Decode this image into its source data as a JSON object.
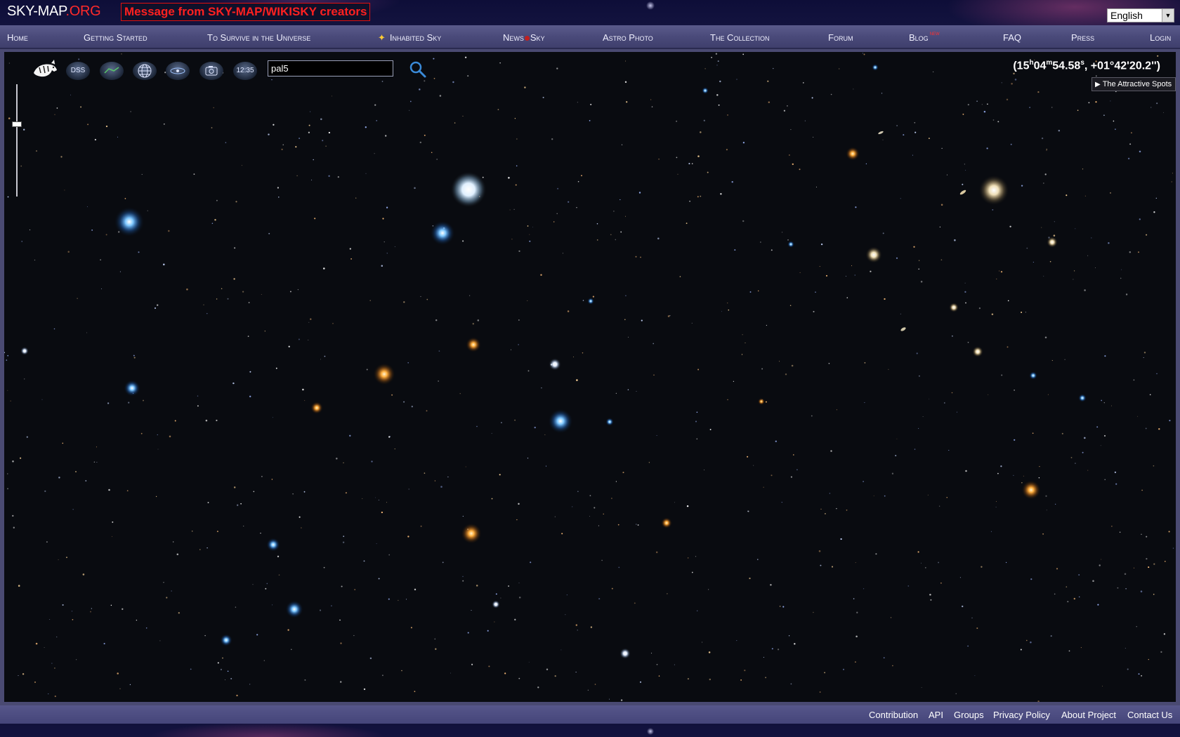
{
  "header": {
    "logo_main": "SKY-MAP",
    "logo_domain": ".ORG",
    "message": "Message from SKY-MAP/WIKISKY creators",
    "language": "English"
  },
  "nav": {
    "items": [
      {
        "label": "Home"
      },
      {
        "label": "Getting Started"
      },
      {
        "label": "To Survive in the Universe"
      },
      {
        "label": "Inhabited Sky"
      },
      {
        "label_a": "News",
        "label_b": "Sky"
      },
      {
        "label": "Astro Photo"
      },
      {
        "label": "The Collection"
      },
      {
        "label": "Forum"
      },
      {
        "label": "Blog",
        "badge": "new"
      },
      {
        "label": "FAQ"
      },
      {
        "label": "Press"
      },
      {
        "label": "Login"
      }
    ]
  },
  "toolbar": {
    "dss_label": "DSS",
    "time_label": "12:35",
    "icons": [
      "tiger-icon",
      "dss-survey-icon",
      "constellation-icon",
      "grid-globe-icon",
      "galaxy-icon",
      "camera-icon",
      "clock-icon",
      "search-icon"
    ],
    "search_value": "pal5"
  },
  "coordinates": {
    "open": "(15",
    "h_unit": "h",
    "min": "04",
    "m_unit": "m",
    "sec": "54.58",
    "s_unit": "s",
    "dec": ", +01°42'20.2'')"
  },
  "attractive_spots": "The Attractive Spots",
  "zoom_level": 0.35,
  "footer": {
    "links": [
      "Contribution",
      "API",
      "Groups",
      "Privacy Policy",
      "About Project",
      "Contact Us"
    ]
  },
  "colors": {
    "header_bg": "#0e0e38",
    "nav_bg": "#4a4a7a",
    "accent_red": "#ff2a2a",
    "sky_bg": "#090b10"
  }
}
